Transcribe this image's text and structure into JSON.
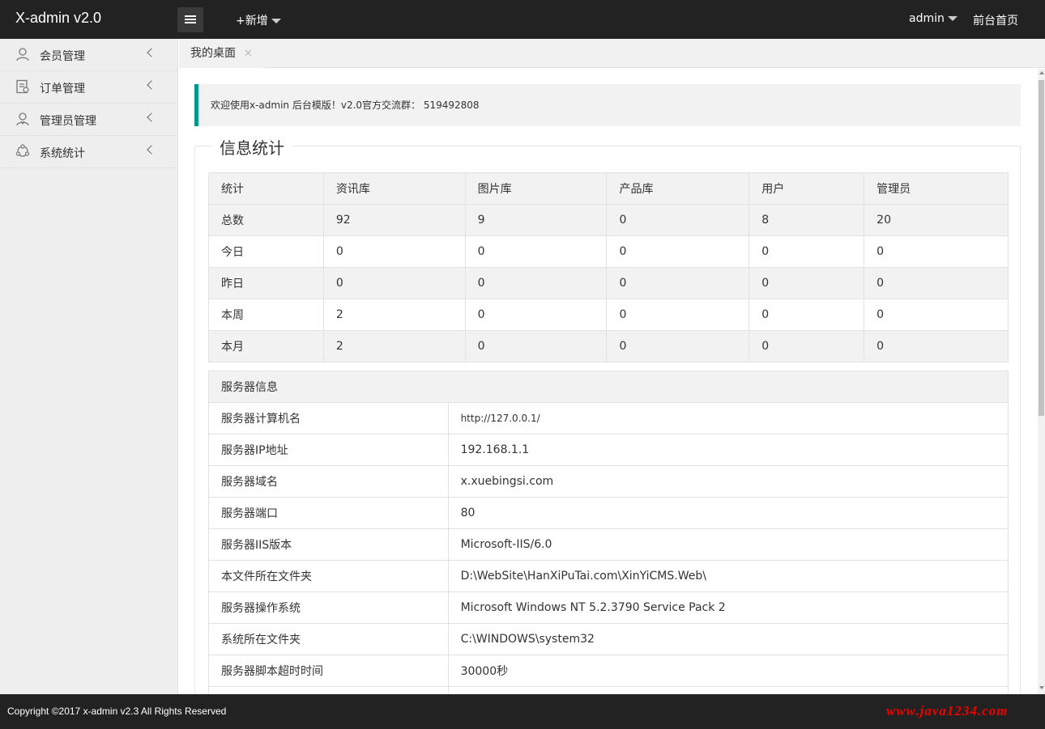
{
  "header": {
    "logo": "X-admin v2.0",
    "add_new": "+新增",
    "user": "admin",
    "home_link": "前台首页"
  },
  "sidebar": {
    "items": [
      {
        "label": "会员管理",
        "icon": "user-icon"
      },
      {
        "label": "订单管理",
        "icon": "order-icon"
      },
      {
        "label": "管理员管理",
        "icon": "admin-icon"
      },
      {
        "label": "系统统计",
        "icon": "stats-icon"
      }
    ]
  },
  "tabs": [
    {
      "label": "我的桌面",
      "close": "✕"
    }
  ],
  "welcome": "欢迎使用x-admin 后台模版！v2.0官方交流群： 519492808",
  "info_title": "信息统计",
  "stats": {
    "headers": [
      "统计",
      "资讯库",
      "图片库",
      "产品库",
      "用户",
      "管理员"
    ],
    "rows": [
      [
        "总数",
        "92",
        "9",
        "0",
        "8",
        "20"
      ],
      [
        "今日",
        "0",
        "0",
        "0",
        "0",
        "0"
      ],
      [
        "昨日",
        "0",
        "0",
        "0",
        "0",
        "0"
      ],
      [
        "本周",
        "2",
        "0",
        "0",
        "0",
        "0"
      ],
      [
        "本月",
        "2",
        "0",
        "0",
        "0",
        "0"
      ]
    ]
  },
  "server": {
    "title": "服务器信息",
    "rows": [
      [
        "服务器计算机名",
        "http://127.0.0.1/"
      ],
      [
        "服务器IP地址",
        "192.168.1.1"
      ],
      [
        "服务器域名",
        "x.xuebingsi.com"
      ],
      [
        "服务器端口",
        "80"
      ],
      [
        "服务器IIS版本",
        "Microsoft-IIS/6.0"
      ],
      [
        "本文件所在文件夹",
        "D:\\WebSite\\HanXiPuTai.com\\XinYiCMS.Web\\"
      ],
      [
        "服务器操作系统",
        "Microsoft Windows NT 5.2.3790 Service Pack 2"
      ],
      [
        "系统所在文件夹",
        "C:\\WINDOWS\\system32"
      ],
      [
        "服务器脚本超时时间",
        "30000秒"
      ],
      [
        "",
        ""
      ]
    ]
  },
  "footer": {
    "copyright": "Copyright ©2017 x-admin v2.3 All Rights Reserved",
    "watermark": "www.java1234.com"
  },
  "colors": {
    "accent": "#009688",
    "header_bg": "#222222",
    "watermark": "#ee0000"
  }
}
